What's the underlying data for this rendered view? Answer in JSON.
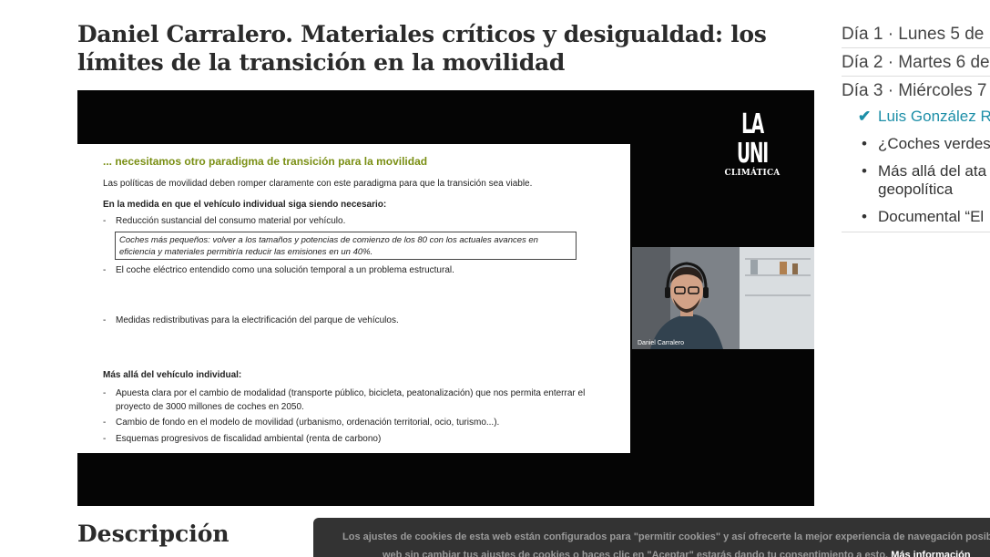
{
  "page": {
    "title": "Daniel Carralero. Materiales críticos y desigualdad: los límites de la transición en la movilidad",
    "description_heading": "Descripción"
  },
  "video": {
    "logo_main": "LA UNI",
    "logo_sub": "CLIMÁTICA",
    "speaker_label": "Daniel Carralero",
    "slide": {
      "heading": "... necesitamos otro paradigma de transición para la movilidad",
      "intro": "Las políticas de movilidad deben romper claramente con este paradigma para que la transición sea viable.",
      "section1": "En la medida en que el vehículo individual siga siendo necesario:",
      "bullet1": "Reducción sustancial del consumo material por vehículo.",
      "quote": "Coches más pequeños: volver a los tamaños y potencias de comienzo de los 80 con los actuales avances en eficiencia y materiales permitiría reducir las emisiones en un 40%.",
      "bullet2": "El coche eléctrico entendido como una solución temporal a un problema estructural.",
      "bullet3": "Medidas redistributivas para la electrificación del parque de vehículos.",
      "section2": "Más allá del vehículo individual:",
      "bullet4": "Apuesta clara por el cambio de modalidad (transporte público, bicicleta, peatonalización) que nos permita enterrar el proyecto de 3000 millones de coches en 2050.",
      "bullet5": "Cambio de fondo en el modelo de movilidad (urbanismo, ordenación territorial, ocio, turismo...).",
      "bullet6": "Esquemas progresivos de fiscalidad ambiental (renta de carbono)",
      "dash": "-"
    }
  },
  "sidebar": {
    "day1": "Día 1 · Lunes 5 de",
    "day2": "Día 2 · Martes 6 de",
    "day3": "Día 3 · Miércoles 7",
    "talks": [
      {
        "label": "Luis González R",
        "marker": "✔"
      },
      {
        "label": "¿Coches verdes",
        "marker": "•"
      },
      {
        "label": "Más allá del ata",
        "label2": "geopolítica",
        "marker": "•"
      },
      {
        "label": "Documental “El",
        "marker": "•"
      }
    ]
  },
  "cookie": {
    "line1": "Los ajustes de cookies de esta web están configurados para \"permitir cookies\" y así ofrecerte la mejor experiencia de navegación posible",
    "line2": "web sin cambiar tus ajustes de cookies o haces clic en \"Aceptar\" estarás dando tu consentimiento a esto.",
    "more_info": "Más información"
  },
  "colors": {
    "accent": "#1d8fa8",
    "slide_heading": "#7a8f14",
    "cookie_bg": "#333333"
  }
}
